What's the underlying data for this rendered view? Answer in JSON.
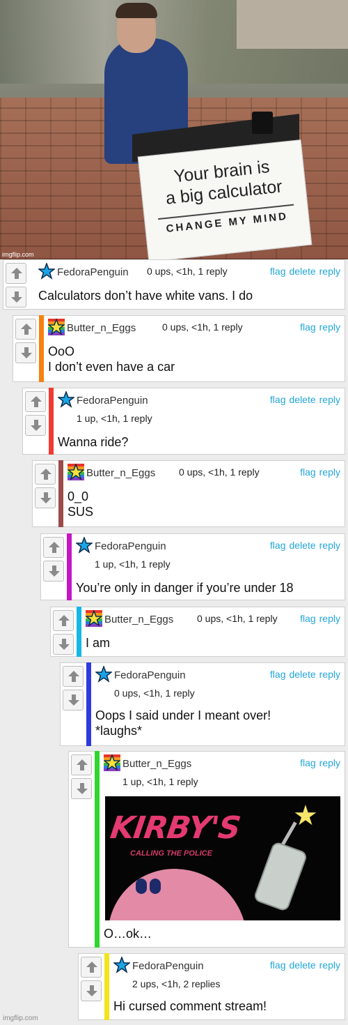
{
  "meme": {
    "sign_line1": "Your brain is",
    "sign_line2": "a big calculator",
    "sign_line3": "CHANGE MY MIND",
    "watermark": "imgflip.com"
  },
  "icons": {
    "up": "arrow-up-icon",
    "down": "arrow-down-icon",
    "blue_star": "blue-star-icon",
    "rainbow_star": "rainbow-star-icon"
  },
  "comments": [
    {
      "user": "FedoraPenguin",
      "meta": "0 ups, <1h, 1 reply",
      "actions": [
        "flag",
        "delete",
        "reply"
      ],
      "text": "Calculators don’t have white vans. I do",
      "stripe": "#ffffff"
    },
    {
      "user": "Butter_n_Eggs",
      "meta": "0 ups, <1h, 1 reply",
      "actions": [
        "flag",
        "reply"
      ],
      "text": "OoO\nI don’t even have a car",
      "stripe": "#f5820d"
    },
    {
      "user": "FedoraPenguin",
      "meta": "1 up, <1h, 1 reply",
      "actions": [
        "flag",
        "delete",
        "reply"
      ],
      "text": "Wanna ride?",
      "stripe": "#ef3b34"
    },
    {
      "user": "Butter_n_Eggs",
      "meta": "0 ups, <1h, 1 reply",
      "actions": [
        "flag",
        "reply"
      ],
      "text": "0_0\nSUS",
      "stripe": "#9c4a4a"
    },
    {
      "user": "FedoraPenguin",
      "meta": "1 up, <1h, 1 reply",
      "actions": [
        "flag",
        "delete",
        "reply"
      ],
      "text": "You’re only in danger if you’re under 18",
      "stripe": "#c516c5"
    },
    {
      "user": "Butter_n_Eggs",
      "meta": "0 ups, <1h, 1 reply",
      "actions": [
        "flag",
        "reply"
      ],
      "text": "I am",
      "stripe": "#14b8e6"
    },
    {
      "user": "FedoraPenguin",
      "meta": "0 ups, <1h, 1 reply",
      "actions": [
        "flag",
        "delete",
        "reply"
      ],
      "text": "Oops I said under I meant over!\n*laughs*",
      "stripe": "#2f3bdc"
    },
    {
      "user": "Butter_n_Eggs",
      "meta": "1 up, <1h, 1 reply",
      "actions": [
        "flag",
        "reply"
      ],
      "text": "O…ok…",
      "stripe": "#2ed62e",
      "image": {
        "title": "KIRBY'S",
        "subtitle": "CALLING THE POLICE"
      }
    },
    {
      "user": "FedoraPenguin",
      "meta": "2 ups, <1h, 2 replies",
      "actions": [
        "flag",
        "delete",
        "reply"
      ],
      "text": "Hi cursed comment stream!",
      "stripe": "#f2e41a"
    }
  ],
  "footer_watermark": "imgflip.com"
}
